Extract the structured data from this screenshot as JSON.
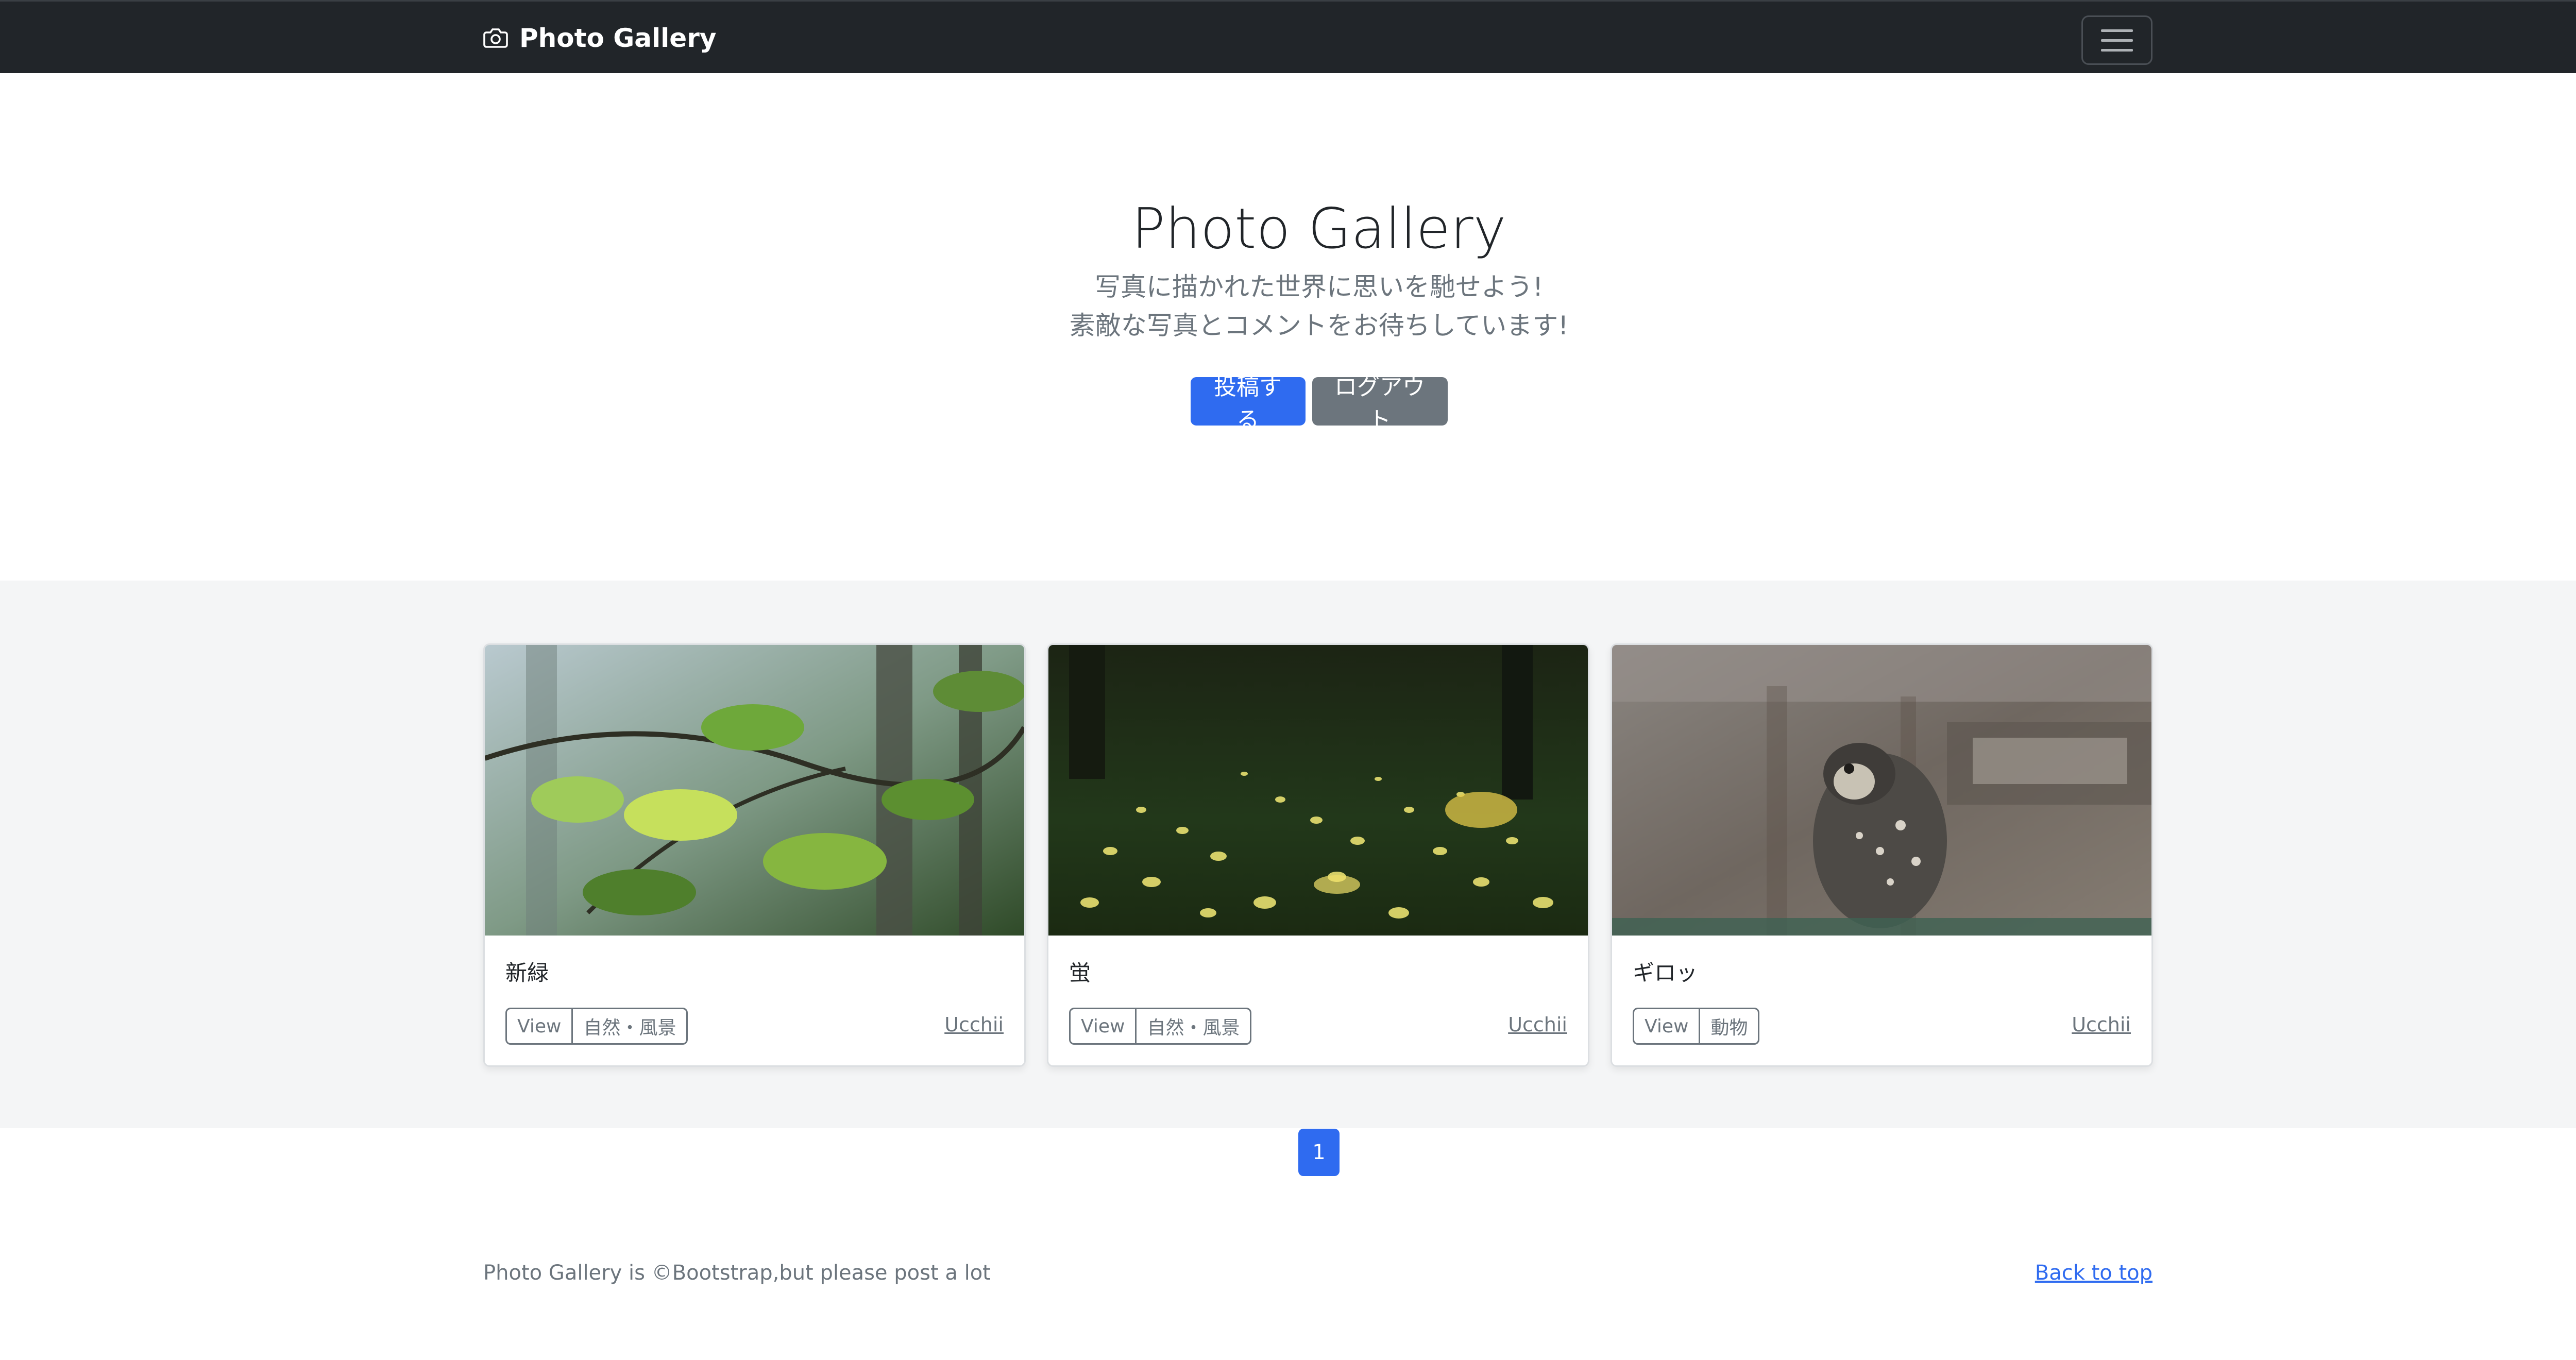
{
  "navbar": {
    "brand": "Photo Gallery",
    "brand_icon": "camera-icon",
    "menu_icon": "hamburger-menu-icon"
  },
  "hero": {
    "title": "Photo Gallery",
    "lead_line1": "写真に描かれた世界に思いを馳せよう!",
    "lead_line2": "素敵な写真とコメントをお待ちしています!",
    "post_button": "投稿する",
    "logout_button": "ログアウト"
  },
  "cards": [
    {
      "title": "新緑",
      "view_label": "View",
      "category": "自然・風景",
      "author": "Ucchii"
    },
    {
      "title": "蛍",
      "view_label": "View",
      "category": "自然・風景",
      "author": "Ucchii"
    },
    {
      "title": "ギロッ",
      "view_label": "View",
      "category": "動物",
      "author": "Ucchii"
    }
  ],
  "pagination": {
    "current": "1"
  },
  "footer": {
    "text": "Photo Gallery is ©Bootstrap,but please post a lot",
    "back_to_top": "Back to top"
  },
  "colors": {
    "navbar_bg": "#212529",
    "primary": "#2f6bf0",
    "secondary": "#6c757d",
    "album_bg": "#f4f5f6"
  }
}
